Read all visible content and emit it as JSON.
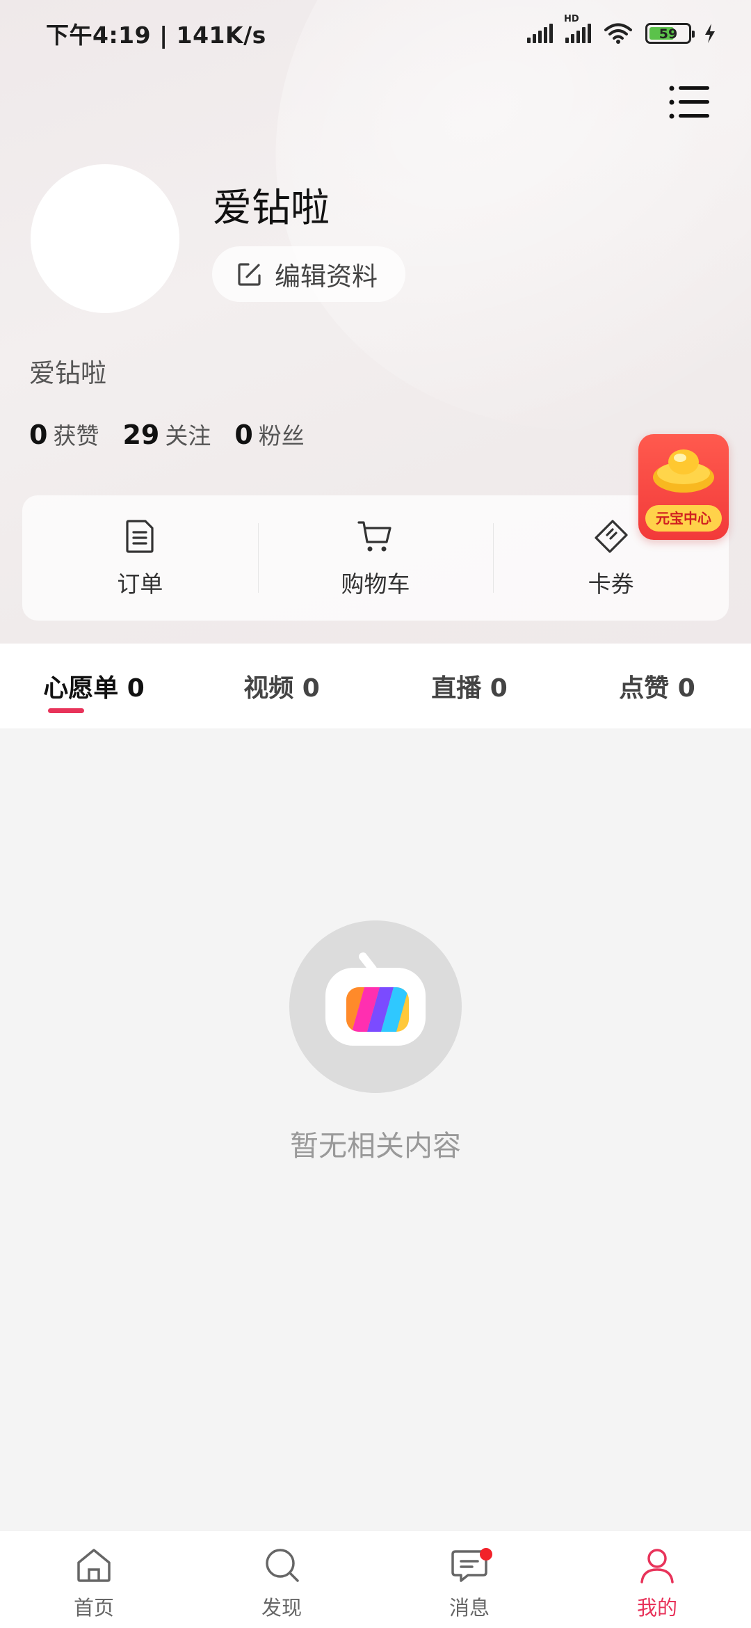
{
  "status_bar": {
    "time_speed": "下午4:19 | 141K/s",
    "hd_label": "HD",
    "battery": "59"
  },
  "profile": {
    "name": "爱钻啦",
    "edit_label": "编辑资料",
    "bio": "爱钻啦",
    "stats": [
      {
        "num": "0",
        "label": "获赞"
      },
      {
        "num": "29",
        "label": "关注"
      },
      {
        "num": "0",
        "label": "粉丝"
      }
    ]
  },
  "yuanbao": {
    "label": "元宝中心"
  },
  "quick": [
    {
      "label": "订单",
      "icon": "order-icon"
    },
    {
      "label": "购物车",
      "icon": "cart-icon"
    },
    {
      "label": "卡券",
      "icon": "coupon-icon"
    }
  ],
  "tabs": [
    {
      "label": "心愿单 0",
      "active": true
    },
    {
      "label": "视频 0",
      "active": false
    },
    {
      "label": "直播 0",
      "active": false
    },
    {
      "label": "点赞 0",
      "active": false
    }
  ],
  "empty": {
    "text": "暂无相关内容"
  },
  "nav": [
    {
      "label": "首页",
      "icon": "home-icon"
    },
    {
      "label": "发现",
      "icon": "discover-icon"
    },
    {
      "label": "消息",
      "icon": "message-icon"
    },
    {
      "label": "我的",
      "icon": "profile-icon",
      "active": true
    }
  ],
  "colors": {
    "accent": "#e8335a",
    "badge": "#f2222a"
  }
}
